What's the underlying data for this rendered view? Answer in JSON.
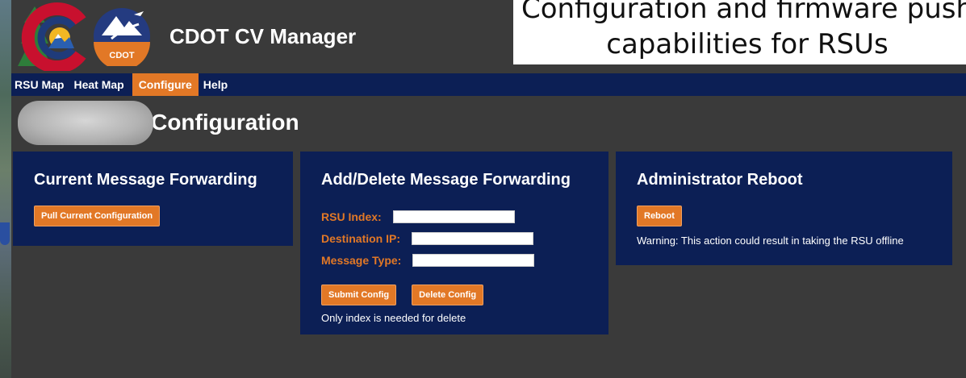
{
  "caption": {
    "line1": "Configuration and firmware push",
    "line2": "capabilities for RSUs"
  },
  "app": {
    "title": "CDOT CV Manager",
    "logo_text": "CDOT"
  },
  "nav": {
    "items": [
      {
        "label": "RSU Map"
      },
      {
        "label": "Heat Map"
      },
      {
        "label": "Configure",
        "active": true
      },
      {
        "label": "Help"
      }
    ]
  },
  "page": {
    "title": ") Configuration"
  },
  "panels": {
    "current": {
      "title": "Current Message Forwarding",
      "pull_label": "Pull Current Configuration"
    },
    "add_delete": {
      "title": "Add/Delete Message Forwarding",
      "rsu_index_label": "RSU Index:",
      "rsu_index_value": "",
      "destination_ip_label": "Destination IP:",
      "destination_ip_value": "",
      "message_type_label": "Message Type:",
      "message_type_value": "",
      "submit_label": "Submit Config",
      "delete_label": "Delete Config",
      "note": "Only index is needed for delete"
    },
    "reboot": {
      "title": "Administrator Reboot",
      "reboot_label": "Reboot",
      "warning": "Warning: This action could result in taking the RSU offline"
    }
  },
  "colors": {
    "navy": "#0c1f55",
    "orange": "#e27826",
    "background": "#3a3a3a"
  }
}
